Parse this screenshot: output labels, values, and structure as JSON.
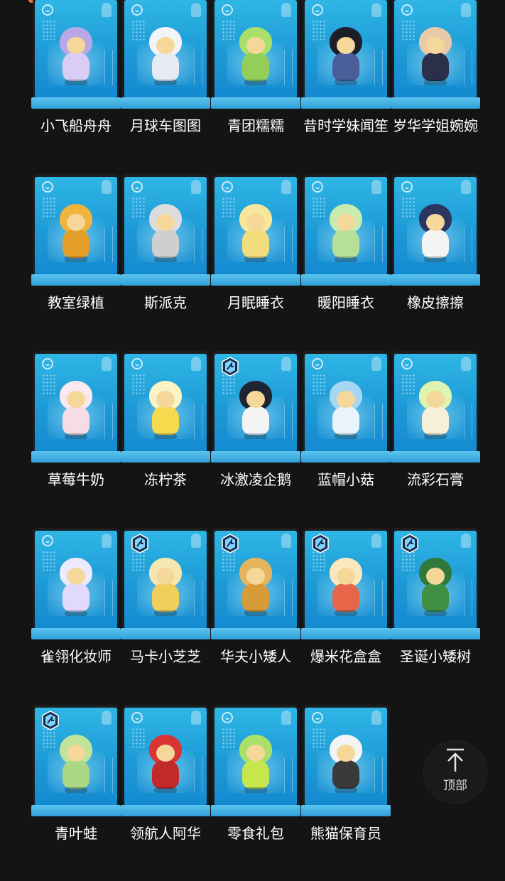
{
  "items": [
    {
      "name": "小飞船舟舟",
      "badge": false,
      "head": "#b9a7e8",
      "body": "#d9ccf5"
    },
    {
      "name": "月球车图图",
      "badge": false,
      "head": "#f2f4f8",
      "body": "#e6ebf2"
    },
    {
      "name": "青团糯糯",
      "badge": false,
      "head": "#a9e06a",
      "body": "#93cf58"
    },
    {
      "name": "昔时学妹闻笙",
      "badge": false,
      "head": "#1e1e28",
      "body": "#4a5e9a"
    },
    {
      "name": "岁华学姐婉婉",
      "badge": false,
      "head": "#e8c9a8",
      "body": "#2c2f4a"
    },
    {
      "name": "教室绿植",
      "badge": false,
      "head": "#f0b43c",
      "body": "#e39f28"
    },
    {
      "name": "斯派克",
      "badge": false,
      "head": "#dcdcdc",
      "body": "#cfcfcf"
    },
    {
      "name": "月眠睡衣",
      "badge": false,
      "head": "#f6e79a",
      "body": "#f2dd7c"
    },
    {
      "name": "暖阳睡衣",
      "badge": false,
      "head": "#c8ebb0",
      "body": "#b6e098"
    },
    {
      "name": "橡皮擦擦",
      "badge": false,
      "head": "#2a3560",
      "body": "#f4f4f4"
    },
    {
      "name": "草莓牛奶",
      "badge": false,
      "head": "#fbe9ef",
      "body": "#f7dbe5"
    },
    {
      "name": "冻柠茶",
      "badge": false,
      "head": "#fbf3c6",
      "body": "#f7d94e"
    },
    {
      "name": "冰激凌企鹅",
      "badge": true,
      "head": "#1f2433",
      "body": "#f4f4f4"
    },
    {
      "name": "蓝帽小菇",
      "badge": false,
      "head": "#a6d7f2",
      "body": "#e8f3fb"
    },
    {
      "name": "流彩石膏",
      "badge": false,
      "head": "#dff4b0",
      "body": "#f7f0d8"
    },
    {
      "name": "雀翎化妆师",
      "badge": false,
      "head": "#efe9ff",
      "body": "#e2dafc"
    },
    {
      "name": "马卡小芝芝",
      "badge": true,
      "head": "#f6e6b0",
      "body": "#f2cf5a"
    },
    {
      "name": "华夫小矮人",
      "badge": true,
      "head": "#e6b45c",
      "body": "#d79b3a"
    },
    {
      "name": "爆米花盒盒",
      "badge": true,
      "head": "#fbe8c0",
      "body": "#e8654a"
    },
    {
      "name": "圣诞小矮树",
      "badge": true,
      "head": "#2f7a3a",
      "body": "#3f8f45"
    },
    {
      "name": "青叶蛙",
      "badge": true,
      "head": "#bfe49a",
      "body": "#aad884"
    },
    {
      "name": "领航人阿华",
      "badge": false,
      "head": "#d93434",
      "body": "#c22a2a"
    },
    {
      "name": "零食礼包",
      "badge": false,
      "head": "#a9e06a",
      "body": "#c7e84c"
    },
    {
      "name": "熊猫保育员",
      "badge": false,
      "head": "#f4f4f4",
      "body": "#3a3a3a"
    }
  ],
  "top_button": {
    "label": "顶部"
  }
}
